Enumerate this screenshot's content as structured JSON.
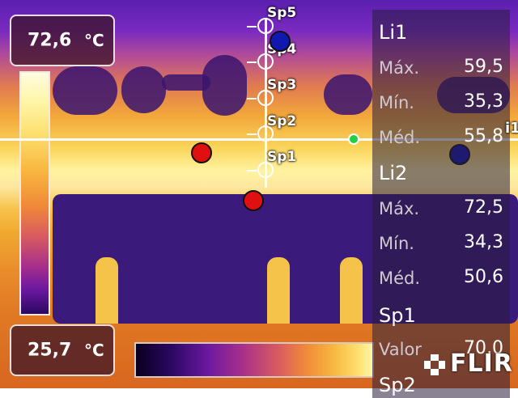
{
  "scale": {
    "max_value": "72,6",
    "max_unit": "°C",
    "min_value": "25,7",
    "min_unit": "°C"
  },
  "spots": [
    "Sp5",
    "Sp4",
    "Sp3",
    "Sp2",
    "Sp1"
  ],
  "panel": {
    "li1": {
      "title": "Li1",
      "max_label": "Máx.",
      "max": "59,5",
      "min_label": "Mín.",
      "min": "35,3",
      "med_label": "Méd.",
      "med": "55,8"
    },
    "li2": {
      "title": "Li2",
      "max_label": "Máx.",
      "max": "72,5",
      "min_label": "Mín.",
      "min": "34,3",
      "med_label": "Méd.",
      "med": "50,6"
    },
    "sp1": {
      "title": "Sp1",
      "value_label": "Valor",
      "value": "70,0"
    },
    "sp2": {
      "title": "Sp2"
    }
  },
  "line_label": "i1",
  "brand": "FLIR",
  "colors": {
    "hot_marker": "#e01010",
    "cold_marker": "#1018b0",
    "accent": "#20d040"
  }
}
